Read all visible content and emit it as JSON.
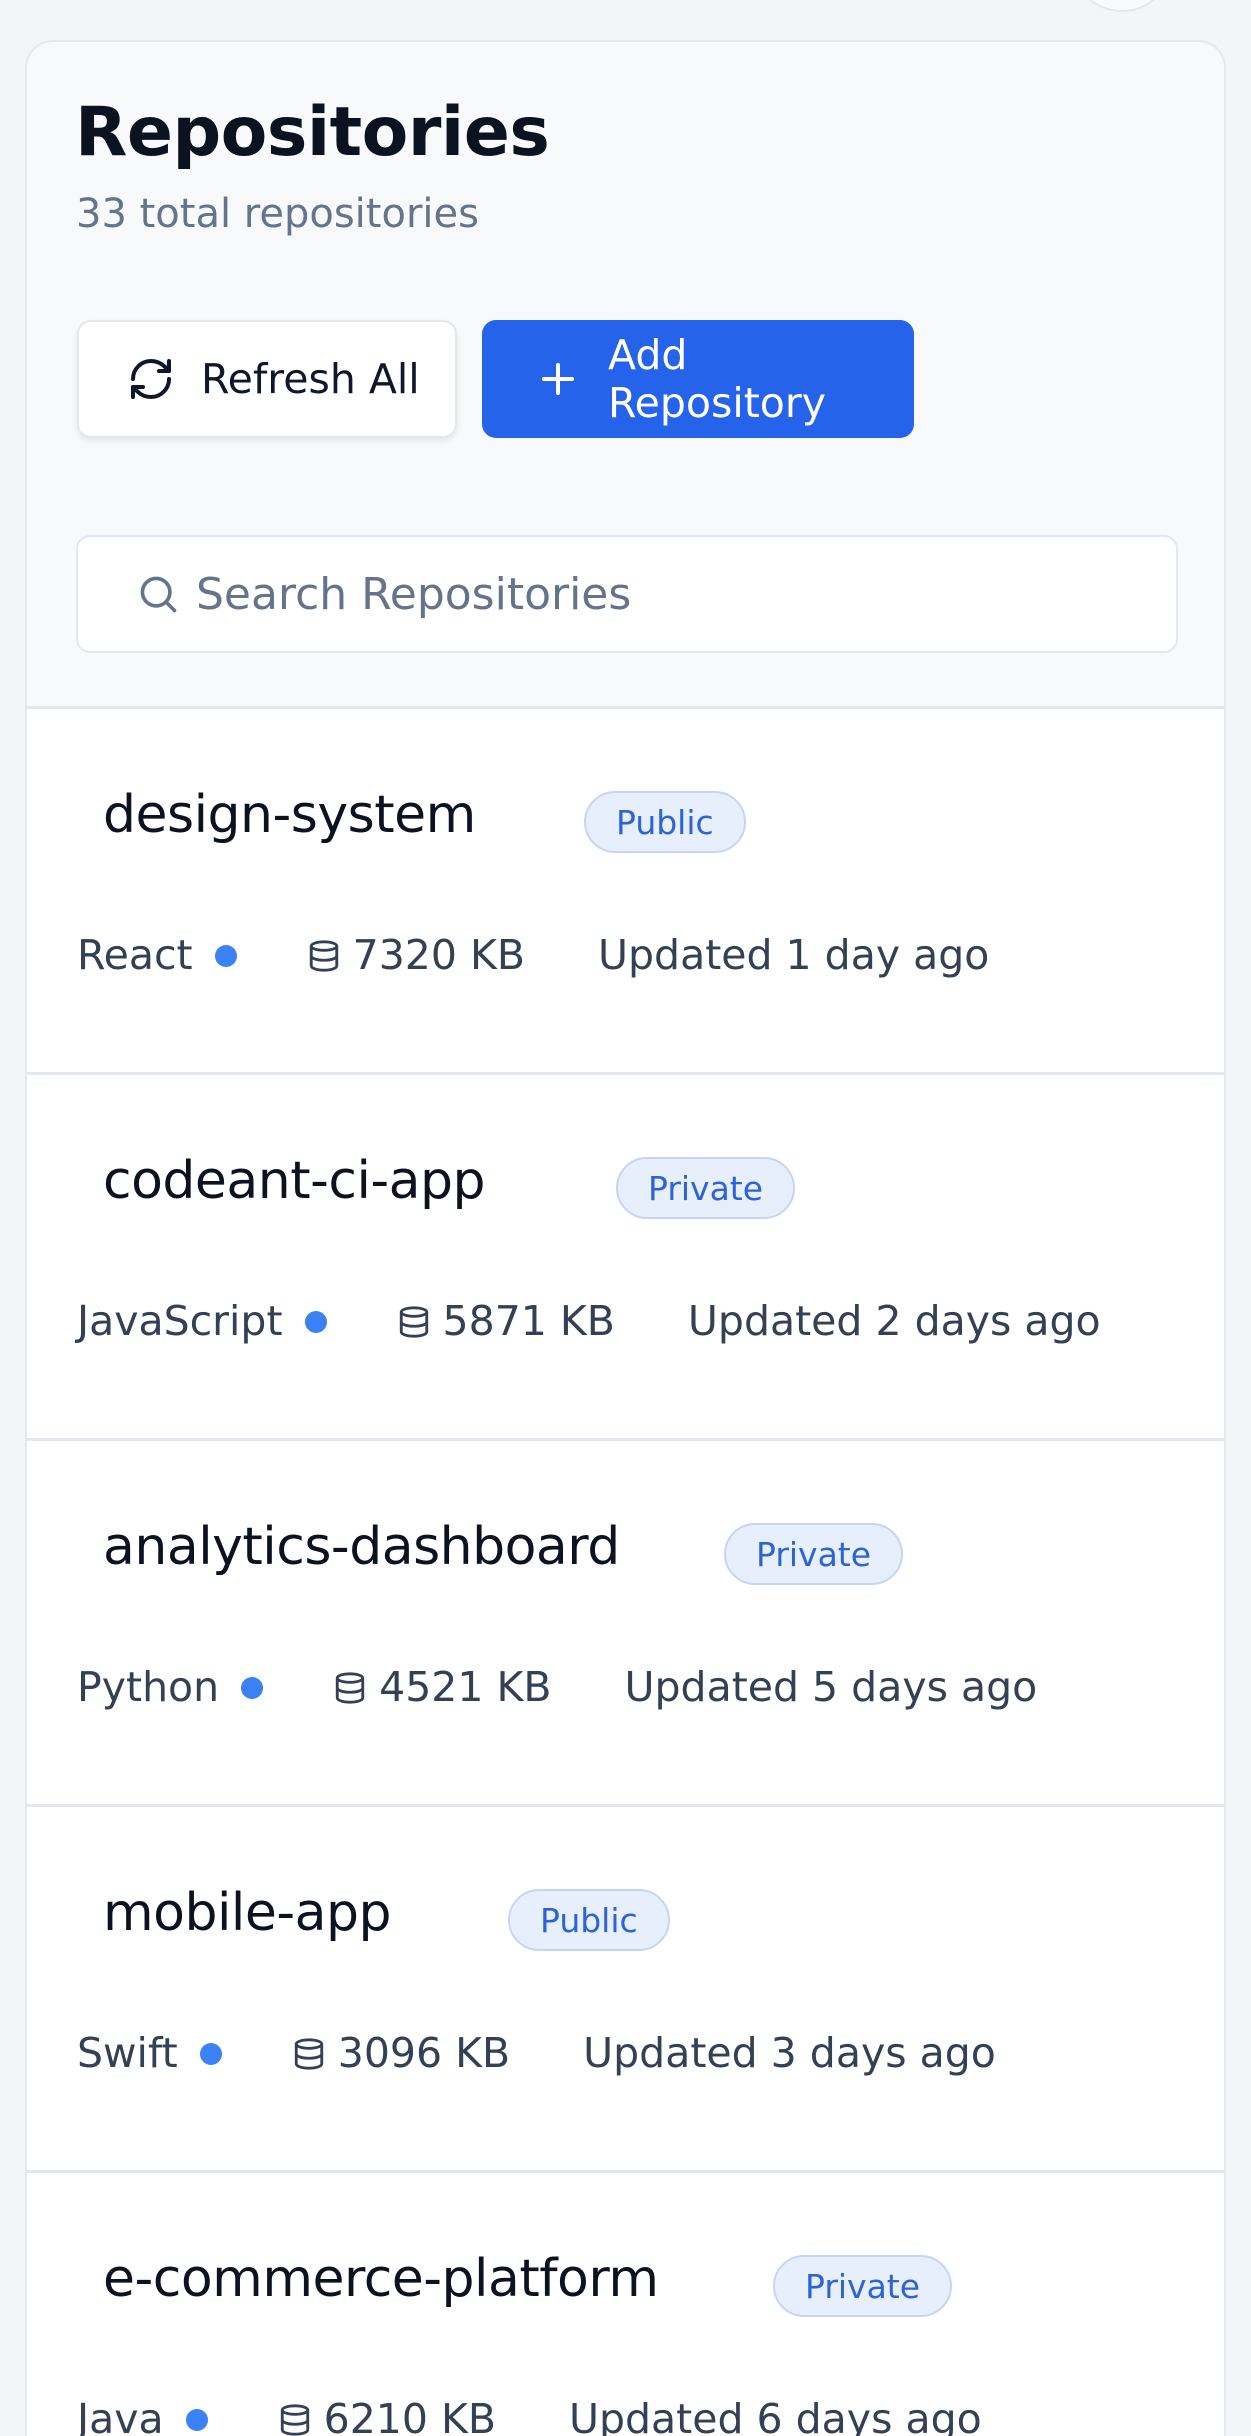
{
  "page": {
    "title": "Repositories",
    "subtitle": "33 total repositories"
  },
  "actions": {
    "refresh_label": "Refresh All",
    "add_label": "Add Repository"
  },
  "search": {
    "placeholder": "Search Repositories",
    "value": ""
  },
  "repositories": [
    {
      "name": "design-system",
      "visibility": "Public",
      "language": "React",
      "language_color": "#3b82f6",
      "size": "7320 KB",
      "updated": "Updated 1 day ago"
    },
    {
      "name": "codeant-ci-app",
      "visibility": "Private",
      "language": "JavaScript",
      "language_color": "#3b82f6",
      "size": "5871 KB",
      "updated": "Updated 2 days ago"
    },
    {
      "name": "analytics-dashboard",
      "visibility": "Private",
      "language": "Python",
      "language_color": "#3b82f6",
      "size": "4521 KB",
      "updated": "Updated 5 days ago"
    },
    {
      "name": "mobile-app",
      "visibility": "Public",
      "language": "Swift",
      "language_color": "#3b82f6",
      "size": "3096 KB",
      "updated": "Updated 3 days ago"
    },
    {
      "name": "e-commerce-platform",
      "visibility": "Private",
      "language": "Java",
      "language_color": "#3b82f6",
      "size": "6210 KB",
      "updated": "Updated 6 days ago"
    }
  ],
  "icons": {
    "refresh": "refresh-icon",
    "add": "plus-icon",
    "search": "search-icon",
    "size": "database-icon"
  },
  "colors": {
    "accent": "#2563eb",
    "badge_text": "#2c63d8",
    "badge_bg": "#e8effc"
  }
}
